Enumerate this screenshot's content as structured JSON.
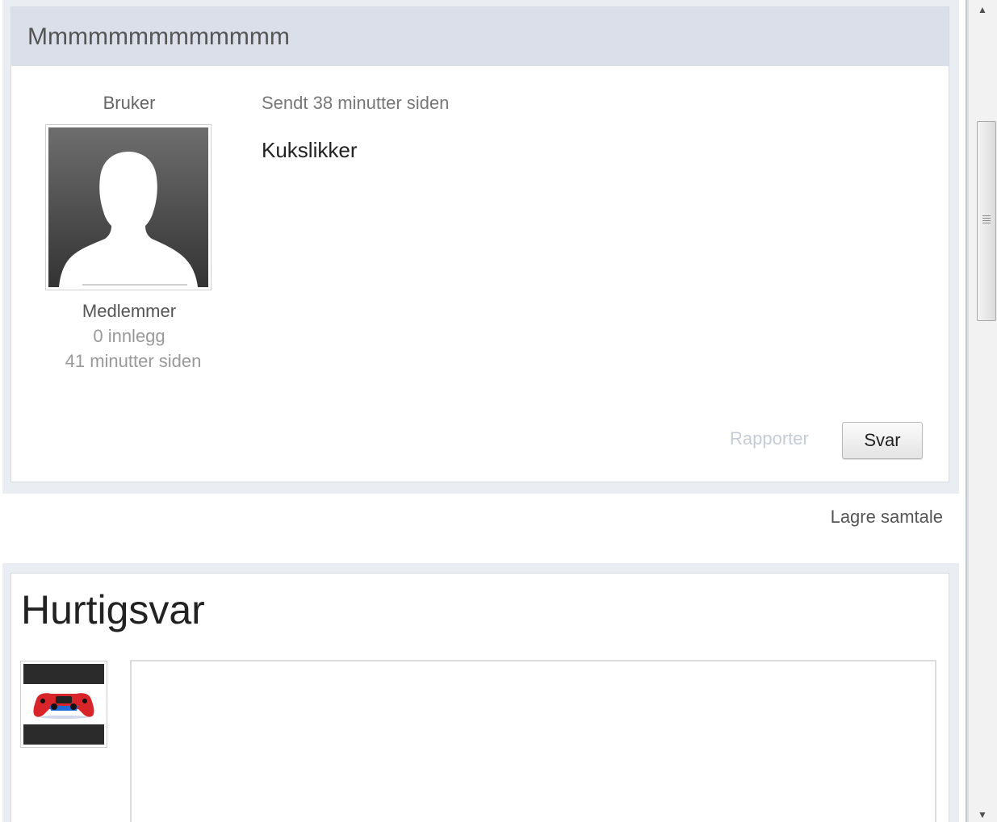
{
  "message": {
    "subject": "Mmmmmmmmmmmmm",
    "author": {
      "name": "Bruker",
      "role": "Medlemmer",
      "posts": "0 innlegg",
      "last_seen": "41 minutter siden",
      "avatar_icon": "default-user-silhouette-icon"
    },
    "sent": "Sendt 38 minutter siden",
    "body": "Kukslikker",
    "report_label": "Rapporter",
    "reply_label": "Svar"
  },
  "save_conversation_label": "Lagre samtale",
  "quick_reply": {
    "title": "Hurtigsvar",
    "avatar_icon": "game-controller-icon",
    "textarea_value": ""
  },
  "scrollbar": {
    "up_arrow": "▲",
    "down_arrow": "▼"
  },
  "colors": {
    "header_bg": "#dadfe9",
    "panel_bg": "#eaeef3",
    "report_link": "#c6ccd6",
    "controller_red": "#d8252a",
    "controller_blue": "#1e6bd8"
  }
}
